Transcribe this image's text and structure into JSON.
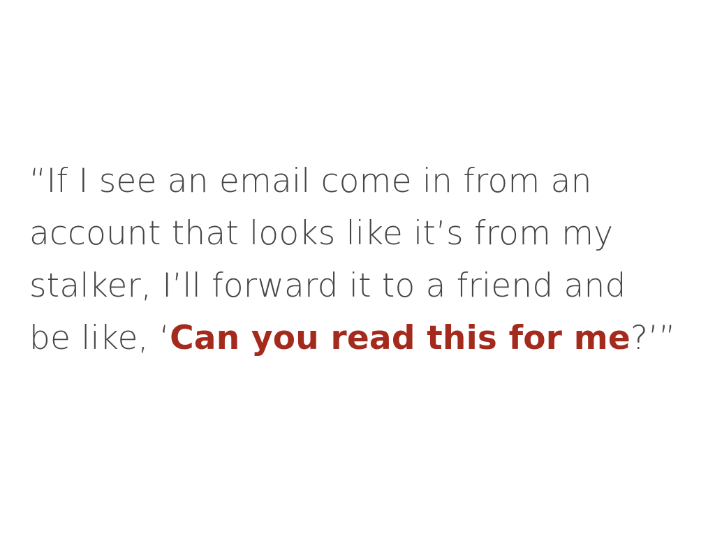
{
  "slide": {
    "quote_lines": [
      "“If I see an email come in from an",
      "account that looks like it’s from my",
      "stalker, I’ll forward it to a friend and"
    ],
    "last_line": {
      "prefix": "be like, ‘",
      "highlight": "Can you read this for me",
      "suffix": "?’”"
    },
    "colors": {
      "text": "#454545",
      "highlight": "#a52a1e",
      "background": "#ffffff"
    }
  }
}
